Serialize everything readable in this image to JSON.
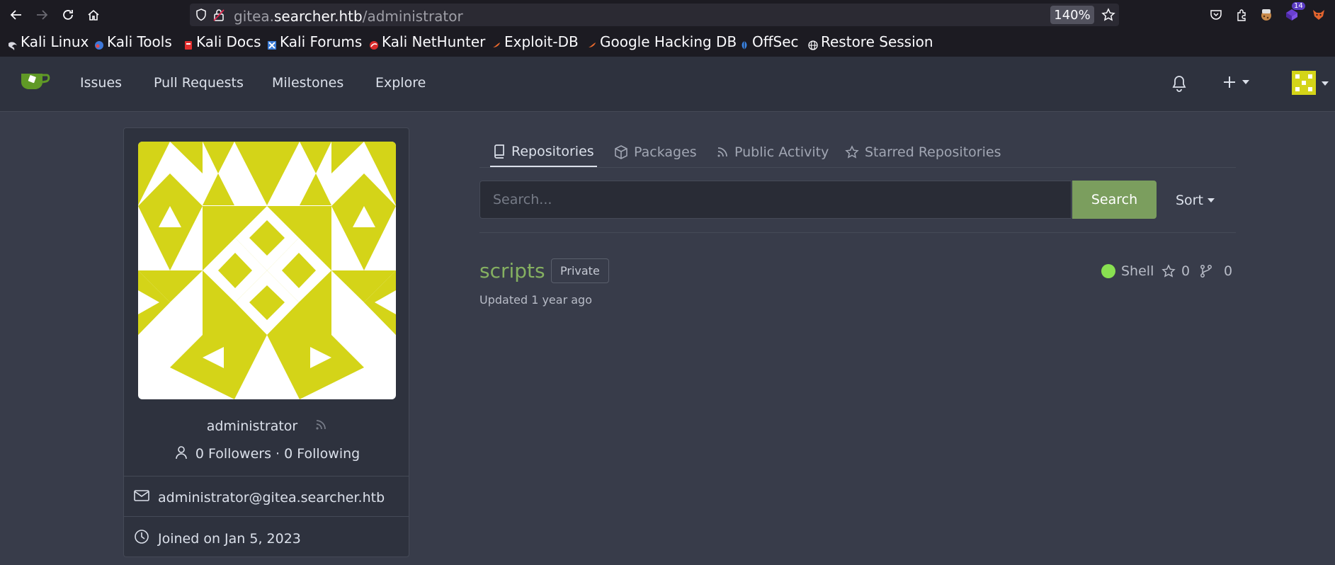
{
  "browser": {
    "url_prefix": "gitea.",
    "url_host": "searcher.htb",
    "url_path": "/administrator",
    "zoom": "140%",
    "extension_badge": "14",
    "bookmarks": [
      {
        "label": "Kali Linux"
      },
      {
        "label": "Kali Tools"
      },
      {
        "label": "Kali Docs"
      },
      {
        "label": "Kali Forums"
      },
      {
        "label": "Kali NetHunter"
      },
      {
        "label": "Exploit-DB"
      },
      {
        "label": "Google Hacking DB"
      },
      {
        "label": "OffSec"
      },
      {
        "label": "Restore Session"
      }
    ]
  },
  "header": {
    "nav": [
      "Issues",
      "Pull Requests",
      "Milestones",
      "Explore"
    ]
  },
  "profile": {
    "username": "administrator",
    "followers": "0 Followers · 0 Following",
    "email": "administrator@gitea.searcher.htb",
    "joined": "Joined on Jan 5, 2023"
  },
  "tabs": [
    "Repositories",
    "Packages",
    "Public Activity",
    "Starred Repositories"
  ],
  "search": {
    "placeholder": "Search...",
    "button": "Search",
    "sort": "Sort"
  },
  "repos": [
    {
      "name": "scripts",
      "visibility": "Private",
      "language": "Shell",
      "language_color": "#89e051",
      "stars": "0",
      "forks": "0",
      "updated": "Updated 1 year ago"
    }
  ],
  "colors": {
    "accent": "#7b9e5e",
    "avatar_fg": "#d4d418"
  }
}
